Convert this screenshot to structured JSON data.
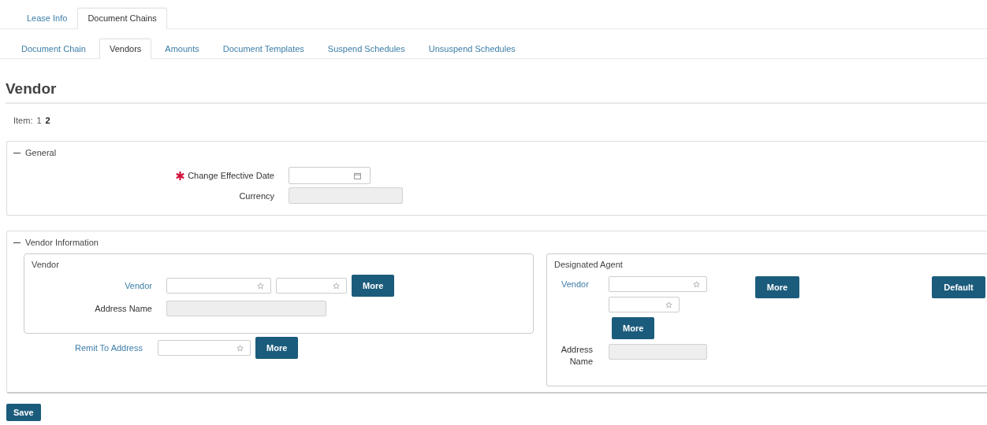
{
  "tabs": [
    {
      "label": "Lease Info",
      "selected": false
    },
    {
      "label": "Document Chains",
      "selected": true
    }
  ],
  "subtabs": [
    {
      "label": "Document Chain",
      "selected": false
    },
    {
      "label": "Vendors",
      "selected": true
    },
    {
      "label": "Amounts",
      "selected": false
    },
    {
      "label": "Document Templates",
      "selected": false
    },
    {
      "label": "Suspend Schedules",
      "selected": false
    },
    {
      "label": "Unsuspend Schedules",
      "selected": false
    }
  ],
  "heading": "Vendor",
  "pager": {
    "label": "Item:",
    "items": [
      {
        "label": "1",
        "selected": false
      },
      {
        "label": "2",
        "selected": true
      }
    ]
  },
  "general": {
    "title": "General",
    "expanded": true,
    "fields": [
      {
        "label": "Change Effective Date",
        "required": true,
        "kind": "date"
      },
      {
        "label": "Currency",
        "required": false,
        "kind": "readonly"
      }
    ]
  },
  "vendor_information": {
    "title": "Vendor Information",
    "expanded": true,
    "vendor_group": {
      "title": "Vendor",
      "vendor_label": "Vendor",
      "more_button": "More",
      "address_label": "Address Name"
    },
    "remit": {
      "label": "Remit To Address",
      "more_button": "More"
    },
    "designated_agent": {
      "title": "Designated Agent",
      "vendor_label": "Vendor",
      "more_button_1": "More",
      "default_button": "Default",
      "more_button_2": "More",
      "address_label": "Address Name"
    }
  },
  "save_button": "Save"
}
